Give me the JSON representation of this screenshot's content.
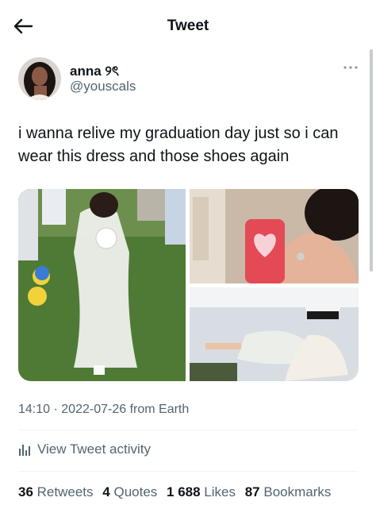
{
  "header": {
    "title": "Tweet"
  },
  "user": {
    "display_name": "anna ୨ৎ",
    "handle": "@youscals"
  },
  "tweet": {
    "text_line1": "i wanna relive my graduation day just so i can",
    "text_line2": "wear this dress and those shoes again"
  },
  "meta": {
    "time": "14:10",
    "separator": "·",
    "date": "2022-07-26",
    "source": "from Earth"
  },
  "activity": {
    "label": "View Tweet activity"
  },
  "stats": {
    "retweets_count": "36",
    "retweets_label": "Retweets",
    "quotes_count": "4",
    "quotes_label": "Quotes",
    "likes_count": "1 688",
    "likes_label": "Likes",
    "bookmarks_count": "87",
    "bookmarks_label": "Bookmarks"
  },
  "icons": {
    "back": "arrow-left-icon",
    "more": "more-horizontal-icon",
    "activity": "bar-chart-icon"
  },
  "colors": {
    "text": "#0f1419",
    "secondary": "#536471",
    "divider": "#eff3f4"
  }
}
